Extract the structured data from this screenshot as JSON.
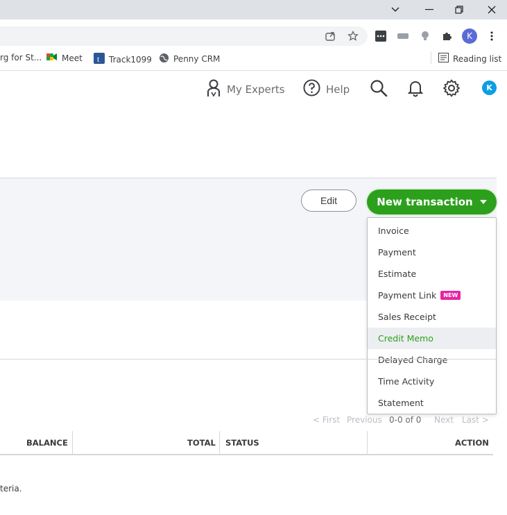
{
  "browser": {
    "bookmarks": [
      {
        "label": "rg for St..."
      },
      {
        "label": "Meet"
      },
      {
        "label": "Track1099"
      },
      {
        "label": "Penny CRM"
      }
    ],
    "reading_list": "Reading list",
    "profile_initial": "K"
  },
  "header": {
    "my_experts": "My Experts",
    "help": "Help",
    "user_initial": "K"
  },
  "actions": {
    "edit_label": "Edit",
    "new_transaction_label": "New transaction"
  },
  "dropdown": {
    "items": [
      {
        "label": "Invoice"
      },
      {
        "label": "Payment"
      },
      {
        "label": "Estimate"
      },
      {
        "label": "Payment Link",
        "badge": "NEW"
      },
      {
        "label": "Sales Receipt"
      },
      {
        "label": "Credit Memo"
      },
      {
        "label": "Delayed Charge"
      },
      {
        "label": "Time Activity"
      },
      {
        "label": "Statement"
      }
    ],
    "highlighted": "Credit Memo"
  },
  "pagination": {
    "first": "< First",
    "previous": "Previous",
    "range": "0-0 of 0",
    "next": "Next",
    "last": "Last >"
  },
  "table": {
    "columns": [
      "BALANCE",
      "TOTAL",
      "STATUS",
      "ACTION"
    ]
  },
  "empty_message": "teria.",
  "colors": {
    "primary_green": "#2ca01c",
    "new_badge": "#e524a6",
    "user_blue": "#0d9ee3"
  }
}
